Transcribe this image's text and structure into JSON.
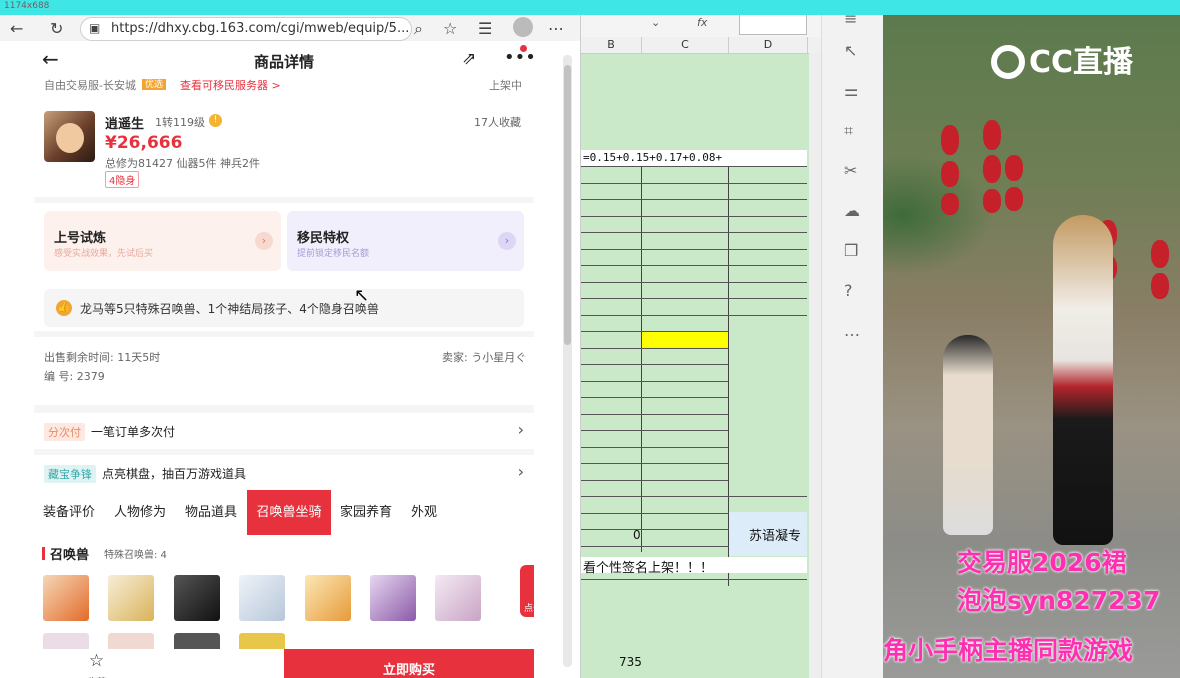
{
  "topstrip": {
    "label": "1174x688"
  },
  "browser": {
    "url": "https://dhxy.cbg.163.com/cgi/mweb/equip/5...",
    "page_title": "商品详情",
    "sub_left": "自由交易服-长安城",
    "sub_badge": "优选",
    "sub_link": "查看可移民服务器 >",
    "sub_right": "上架中",
    "role": {
      "name": "逍遥生",
      "level": "1转119级",
      "favorites": "17人收藏",
      "price": "¥26,666",
      "stats": "总修为81427  仙器5件  神兵2件",
      "tag": "4隐身"
    },
    "promo1": {
      "title": "上号试炼",
      "sub": "感受实战效果，先试后买"
    },
    "promo2": {
      "title": "移民特权",
      "sub": "提前锁定移民名额"
    },
    "special": "龙马等5只特殊召唤兽、1个神结局孩子、4个隐身召唤兽",
    "sale_time": "出售剩余时间: 11天5时",
    "seller": "卖家: う小星月ぐ",
    "serial": "编  号: 2379",
    "installment_tag": "分次付",
    "installment_text": "一笔订单多次付",
    "lottery_tag": "藏宝争锋",
    "lottery_text": "点亮棋盘，抽百万游戏道具",
    "tabs": [
      "装备评价",
      "人物修为",
      "物品道具",
      "召唤兽坐骑",
      "家园养育",
      "外观"
    ],
    "pets_title": "召唤兽",
    "pets_sub": "特殊召唤兽: 4",
    "gift_label": "点击领",
    "fav_label": "收藏",
    "buy_label": "立即购买"
  },
  "sheet": {
    "name_box": "",
    "fx": "fx",
    "col_b": "B",
    "col_c": "C",
    "col_d": "D",
    "formula": "=0.15+0.15+0.17+0.08+",
    "zero": "0",
    "su_text": "苏语凝专",
    "sign_text": "看个性签名上架！！！",
    "num_735": "735"
  },
  "video": {
    "logo": "CC直播",
    "line1": "交易服2026裙",
    "line2": "泡泡syn827237",
    "line3": "角小手柄主播同款游戏"
  },
  "colors": {
    "accent": "#e7323e",
    "cyan": "#3fe6e6",
    "sheet_green": "#c9e9c9",
    "highlight": "#ffff00",
    "overlay_pink": "#ff2fb1"
  }
}
